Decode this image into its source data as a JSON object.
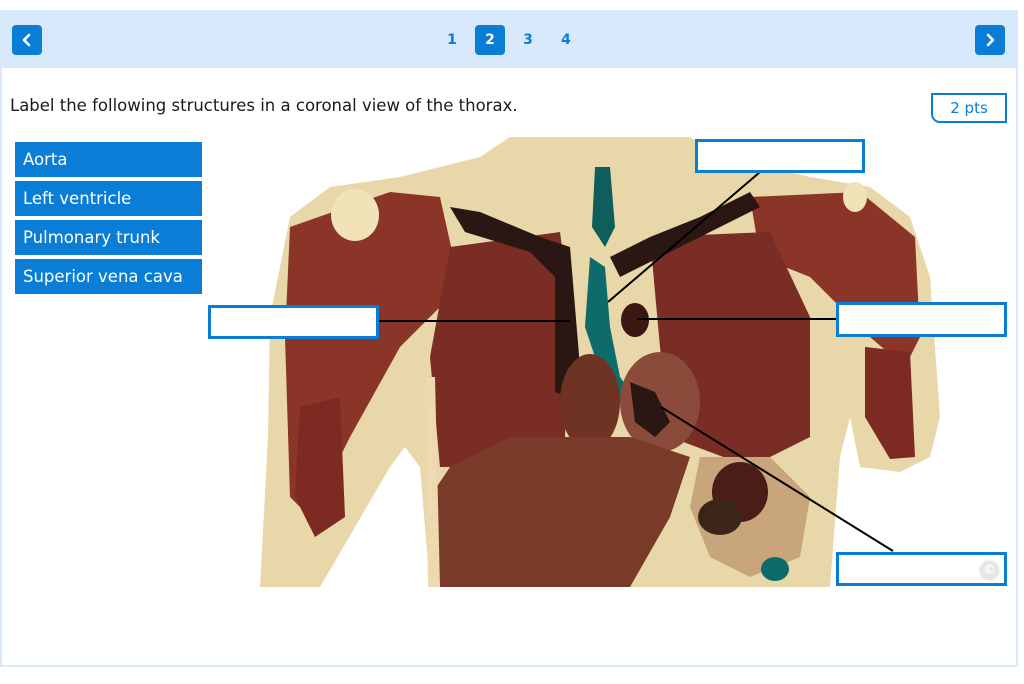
{
  "navigation": {
    "prev_label": "Previous",
    "next_label": "Next",
    "pages": [
      "1",
      "2",
      "3",
      "4"
    ],
    "current_page": "2"
  },
  "question": {
    "prompt": "Label the following structures in a coronal view of the thorax.",
    "points": "2 pts"
  },
  "choices": [
    {
      "label": "Aorta"
    },
    {
      "label": "Left ventricle"
    },
    {
      "label": "Pulmonary trunk"
    },
    {
      "label": "Superior vena cava"
    }
  ],
  "figure": {
    "description": "Coronal cross-section of human thorax",
    "dropzones": [
      {
        "id": "top",
        "value": ""
      },
      {
        "id": "left",
        "value": ""
      },
      {
        "id": "right",
        "value": ""
      },
      {
        "id": "bottom",
        "value": ""
      }
    ],
    "copyright_symbol": "©"
  },
  "colors": {
    "accent": "#0a7ed6",
    "header_bg": "#d8e9fb"
  }
}
